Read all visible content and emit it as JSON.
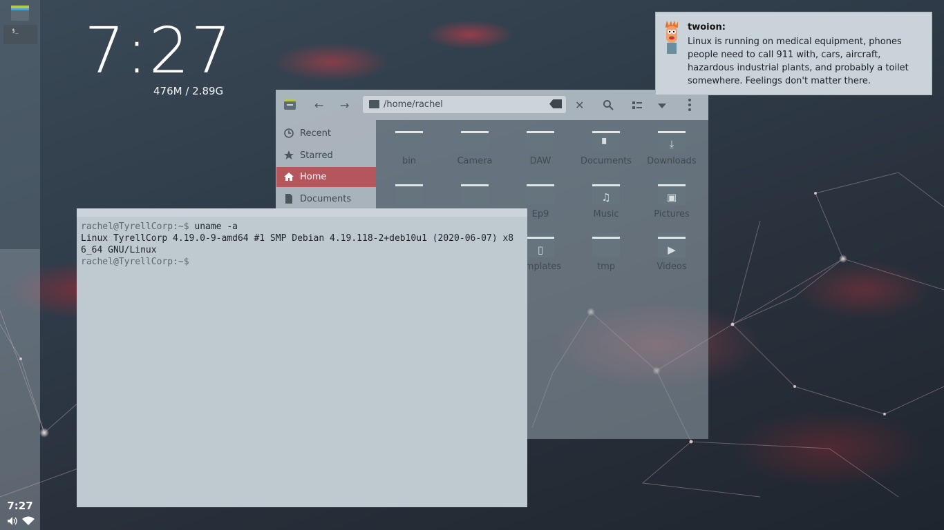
{
  "desktop": {
    "clock": "7:27",
    "memory": "476M / 2.89G"
  },
  "dock": {
    "clock": "7:27",
    "terminal_glyph": "$_",
    "icons": [
      "file-manager-icon",
      "terminal-icon",
      "volume-icon",
      "wifi-icon"
    ]
  },
  "file_manager": {
    "path": "/home/rachel",
    "sidebar": [
      {
        "label": "Recent",
        "icon": "clock-icon"
      },
      {
        "label": "Starred",
        "icon": "star-icon"
      },
      {
        "label": "Home",
        "icon": "home-icon",
        "active": true
      },
      {
        "label": "Documents",
        "icon": "document-icon"
      }
    ],
    "folders": [
      {
        "label": "bin",
        "glyph": ""
      },
      {
        "label": "Camera",
        "glyph": ""
      },
      {
        "label": "DAW",
        "glyph": ""
      },
      {
        "label": "Documents",
        "glyph": "▘"
      },
      {
        "label": "Downloads",
        "glyph": "⤓"
      },
      {
        "label": "",
        "glyph": ""
      },
      {
        "label": "",
        "glyph": ""
      },
      {
        "label": "Ep9",
        "glyph": ""
      },
      {
        "label": "Music",
        "glyph": "♫"
      },
      {
        "label": "Pictures",
        "glyph": "▣"
      },
      {
        "label": "",
        "glyph": ""
      },
      {
        "label": "",
        "glyph": ""
      },
      {
        "label": "emplates",
        "glyph": "▯"
      },
      {
        "label": "tmp",
        "glyph": ""
      },
      {
        "label": "Videos",
        "glyph": "▶"
      }
    ]
  },
  "terminal": {
    "lines": [
      {
        "prompt": "rachel@TyrellCorp:~$ ",
        "text": "uname -a"
      },
      {
        "prompt": "",
        "text": "Linux TyrellCorp 4.19.0-9-amd64 #1 SMP Debian 4.19.118-2+deb10u1 (2020-06-07) x8"
      },
      {
        "prompt": "",
        "text": "6_64 GNU/Linux"
      },
      {
        "prompt": "rachel@TyrellCorp:~$ ",
        "text": ""
      }
    ]
  },
  "notification": {
    "title": "twoion:",
    "body": "Linux is running on medical equipment, phones people need to call 911 with, cars, aircraft, hazardous industrial plants, and probably a toilet somewhere. Feelings don't matter there."
  }
}
